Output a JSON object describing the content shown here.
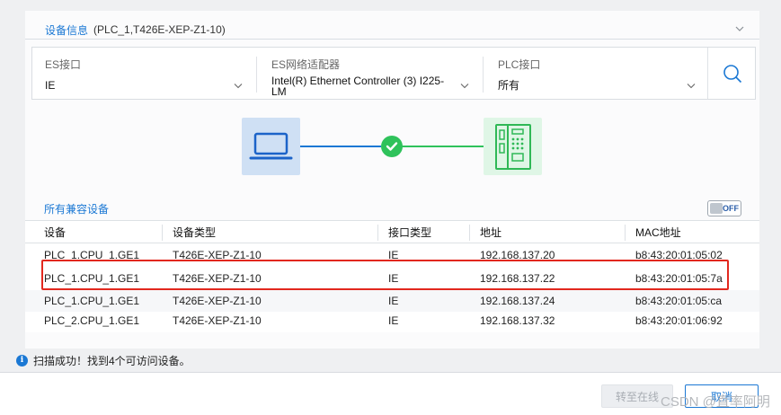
{
  "device_info": {
    "title": "设备信息",
    "subtitle": "(PLC_1,T426E-XEP-Z1-10)",
    "collapse_icon": "chevron-down-icon"
  },
  "filters": {
    "es_interface": {
      "label": "ES接口",
      "value": "IE"
    },
    "es_adapter": {
      "label": "ES网络适配器",
      "value_line1": "Intel(R) Ethernet Controller (3) I225-",
      "value_line2": "LM"
    },
    "plc_interface": {
      "label": "PLC接口",
      "value": "所有"
    },
    "search_icon": "search-icon"
  },
  "diagram": {
    "left_icon": "laptop-icon",
    "status_icon": "check-circle-icon",
    "right_icon": "plc-device-icon"
  },
  "devices": {
    "title": "所有兼容设备",
    "toggle_text": "OFF",
    "columns": [
      "设备",
      "设备类型",
      "接口类型",
      "地址",
      "MAC地址"
    ],
    "rows": [
      [
        "PLC_1.CPU_1.GE1",
        "T426E-XEP-Z1-10",
        "IE",
        "192.168.137.20",
        "b8:43:20:01:05:02"
      ],
      [
        "PLC_1.CPU_1.GE1",
        "T426E-XEP-Z1-10",
        "IE",
        "192.168.137.22",
        "b8:43:20:01:05:7a"
      ],
      [
        "PLC_1.CPU_1.GE1",
        "T426E-XEP-Z1-10",
        "IE",
        "192.168.137.24",
        "b8:43:20:01:05:ca"
      ],
      [
        "PLC_2.CPU_1.GE1",
        "T426E-XEP-Z1-10",
        "IE",
        "192.168.137.32",
        "b8:43:20:01:06:92"
      ]
    ]
  },
  "status": {
    "icon": "info-icon",
    "message": "扫描成功！找到4个可访问设备。"
  },
  "buttons": {
    "go_online": "转至在线",
    "cancel": "取消"
  },
  "watermark": "CSDN @直率阿明",
  "colors": {
    "accent": "#1b78d4",
    "success": "#2fc25b",
    "highlight": "#e2281e"
  }
}
